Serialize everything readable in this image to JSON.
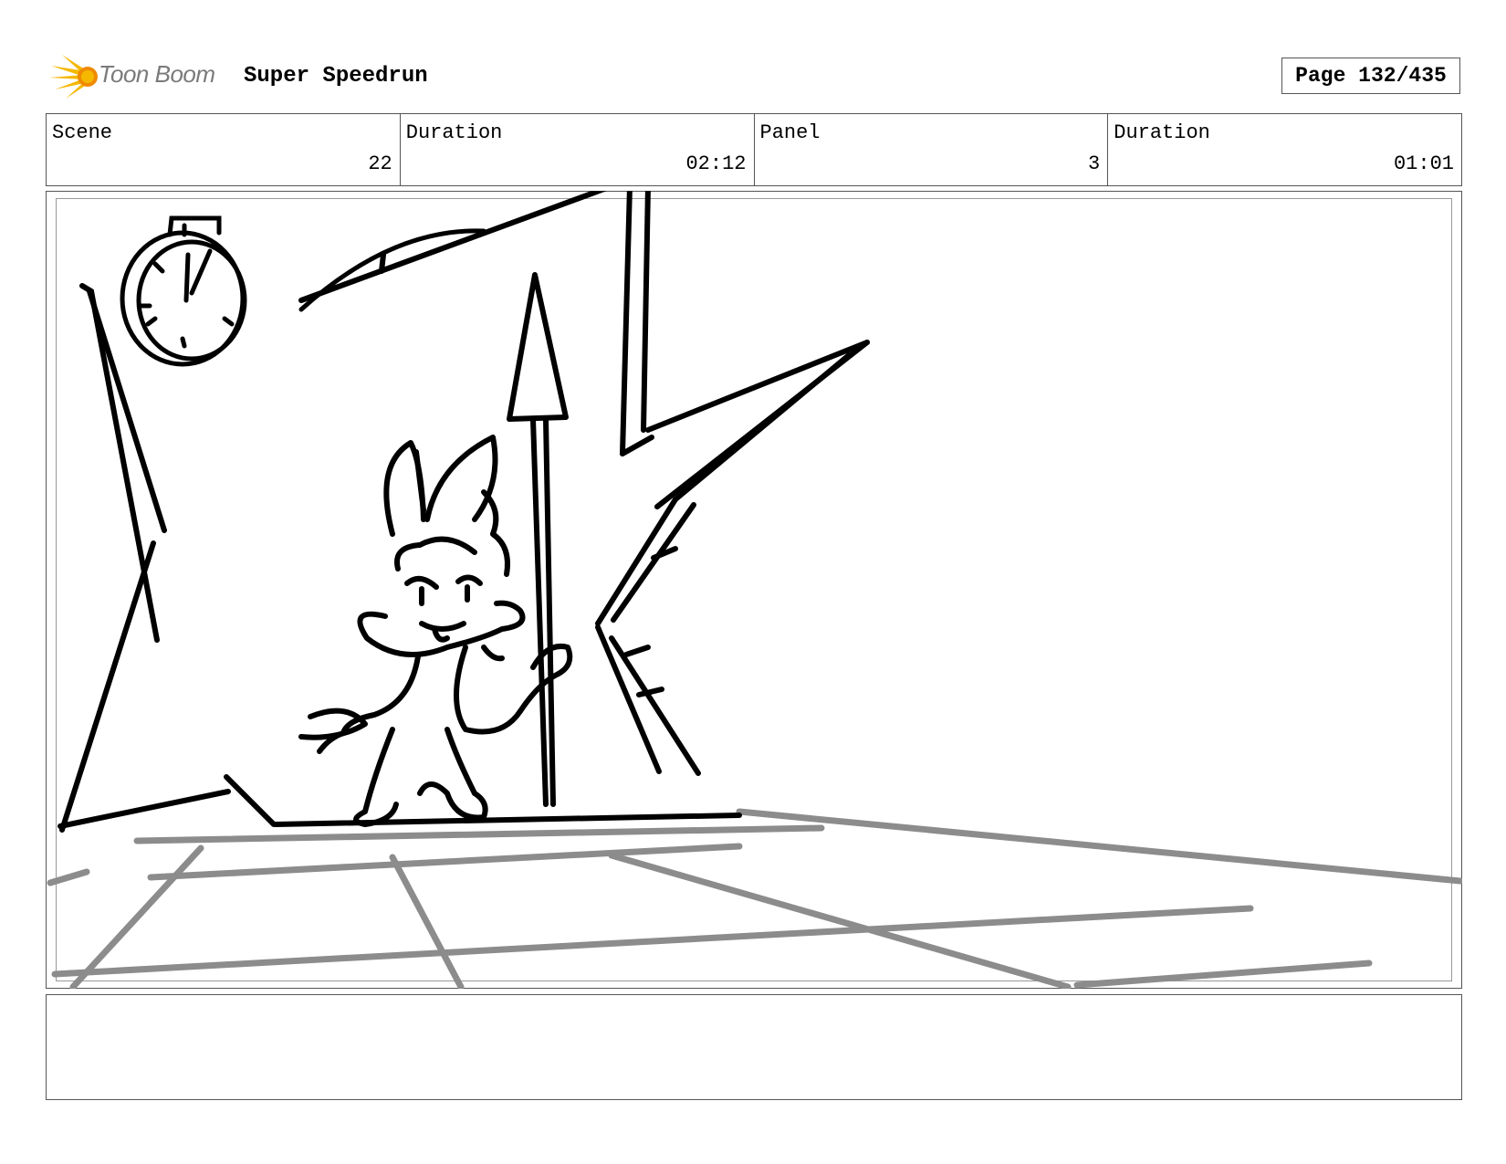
{
  "header": {
    "logo_text": "Toon Boom",
    "project_title": "Super Speedrun",
    "page_label": "Page 132/435"
  },
  "info": {
    "scene_label": "Scene",
    "scene_value": "22",
    "scene_duration_label": "Duration",
    "scene_duration_value": "02:12",
    "panel_label": "Panel",
    "panel_value": "3",
    "panel_duration_label": "Duration",
    "panel_duration_value": "01:01"
  },
  "notes": {
    "text": ""
  },
  "colors": {
    "logo_yellow": "#f5b800",
    "logo_orange": "#f08a00",
    "floor_grey": "#8c8c8c"
  }
}
